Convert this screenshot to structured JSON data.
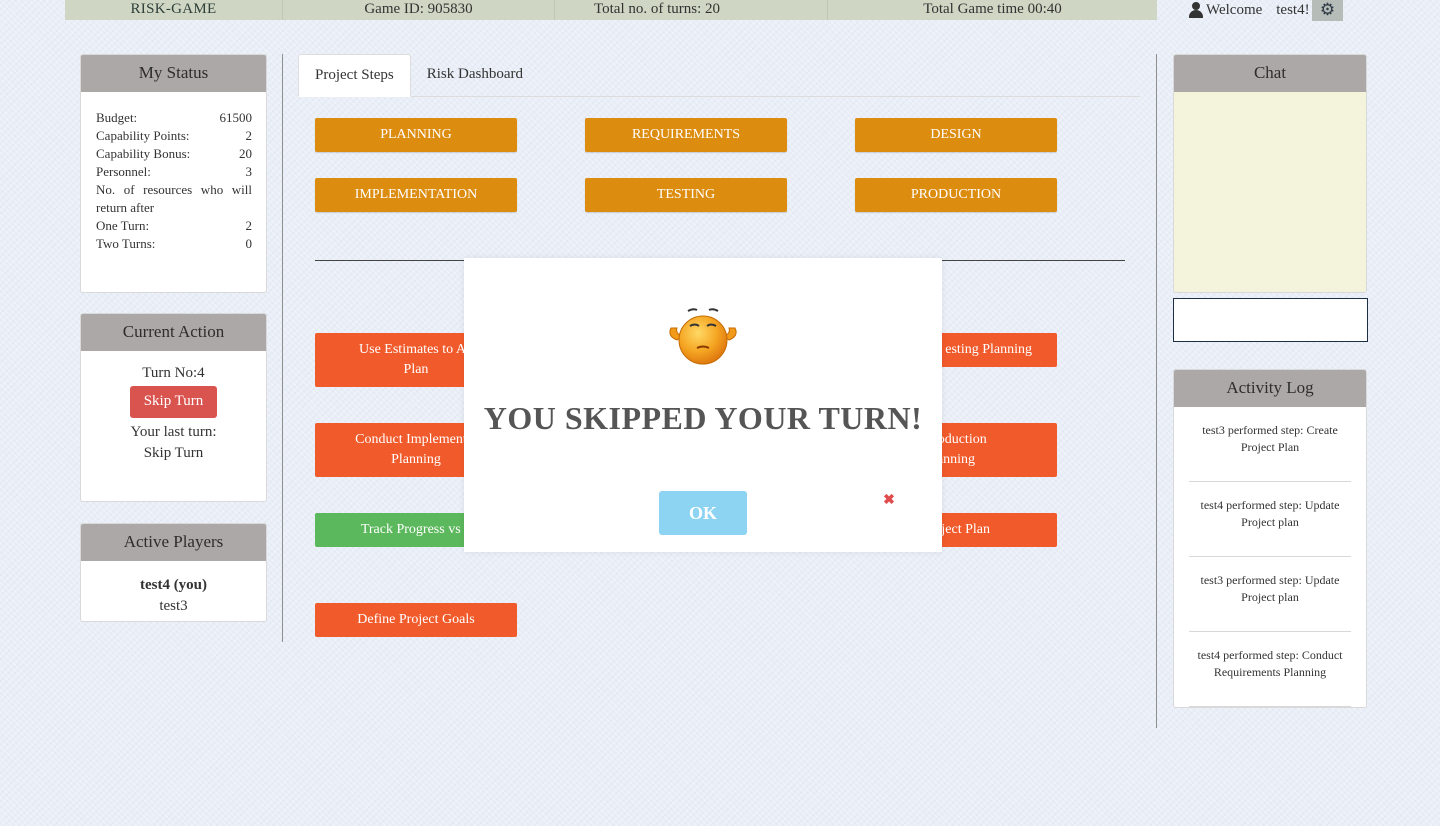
{
  "topbar": {
    "brand": "RISK-GAME",
    "game_id": "Game  ID: 905830",
    "total_turns": "Total  no. of turns:  20",
    "total_time": "Total  Game  time 00:40",
    "welcome": "Welcome",
    "username": "test4!"
  },
  "my_status": {
    "title": "My Status",
    "budget_label": "Budget:",
    "budget_value": "61500",
    "cap_points_label": "Capability  Points:",
    "cap_points_value": "2",
    "cap_bonus_label": "Capability  Bonus:",
    "cap_bonus_value": "20",
    "personnel_label": "Personnel:",
    "personnel_value": "3",
    "resources_note": "No. of resources  who  will return  after",
    "one_turn_label": "One Turn:",
    "one_turn_value": "2",
    "two_turns_label": "Two Turns:",
    "two_turns_value": "0"
  },
  "current_action": {
    "title": "Current  Action",
    "turn_no": "Turn No:4",
    "skip_button": "Skip Turn",
    "last_turn_label": "Your last turn:",
    "last_turn_value": "Skip  Turn"
  },
  "active_players": {
    "title": "Active Players",
    "me": "test4 (you)",
    "other": "test3"
  },
  "tabs": {
    "project_steps": "Project  Steps",
    "risk_dashboard": "Risk Dashboard"
  },
  "phases": {
    "planning": "PLANNING",
    "requirements": "REQUIREMENTS",
    "design": "DESIGN",
    "implementation": "IMPLEMENTATION",
    "testing": "TESTING",
    "production": "PRODUCTION"
  },
  "steps": {
    "use_estimates": "Use Estimates  to Ad\nPlan",
    "testing_planning": "esting  Planning",
    "conduct_impl": "Conduct  Implementat\nPlanning",
    "production_planning": "Production\nanning",
    "track_progress": "Track Progress  vs p",
    "project_plan": "Project Plan",
    "define_goals": "Define  Project Goals"
  },
  "chat": {
    "title": "Chat",
    "input_value": ""
  },
  "activity_log": {
    "title": "Activity  Log",
    "entries": [
      "test3  performed   step:  Create Project  Plan",
      "test4  performed   step:  Update Project  plan",
      "test3  performed   step:  Update Project  plan",
      "test4  performed   step:  Conduct Requirements   Planning"
    ]
  },
  "modal": {
    "message": "YOU SKIPPED YOUR TURN!",
    "ok_button": "OK",
    "close_glyph": "✖"
  },
  "icons": {
    "user": "user-icon",
    "settings": "gear-icon",
    "emoji": "shrug-emoji-icon"
  },
  "colors": {
    "phase_orange": "#dc8c0f",
    "step_red": "#f15a2b",
    "step_green": "#5cb85c",
    "skip_red": "#d9534f",
    "ok_blue": "#8dd3f2",
    "panel_head": "#aca8a7",
    "chat_bg": "#f4f4dc"
  }
}
